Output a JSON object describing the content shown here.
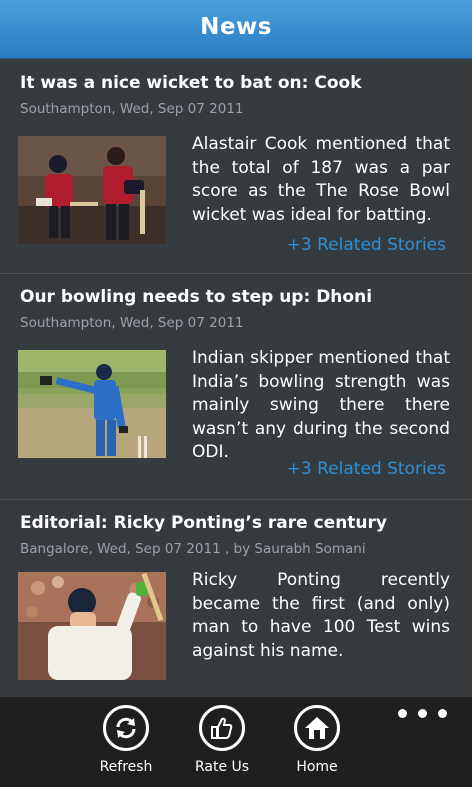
{
  "header": {
    "title": "News"
  },
  "articles": [
    {
      "title": "It was a nice wicket to bat on: Cook",
      "meta": "Southampton, Wed, Sep 07 2011",
      "summary": "Alastair Cook mentioned that the total of 187 was a par score as the The Rose Bowl wicket was ideal for batting.",
      "related": "+3 Related Stories"
    },
    {
      "title": "Our bowling needs to step up: Dhoni",
      "meta": "Southampton, Wed, Sep 07 2011",
      "summary": "Indian skipper mentioned that India’s bowling strength was mainly swing there there wasn’t any during the second ODI.",
      "related": "+3 Related Stories"
    },
    {
      "title": "Editorial: Ricky Ponting’s rare century",
      "meta": "Bangalore, Wed, Sep 07 2011 , by Saurabh Somani",
      "summary": "Ricky Ponting recently became the first (and only) man to have 100 Test wins against his name."
    }
  ],
  "appbar": {
    "buttons": [
      {
        "label": "Refresh",
        "icon": "refresh-icon"
      },
      {
        "label": "Rate Us",
        "icon": "thumbs-up-icon"
      },
      {
        "label": "Home",
        "icon": "home-icon"
      }
    ],
    "more_icon": "ellipsis-icon"
  },
  "colors": {
    "header": "#2f86c9",
    "background": "#363b40",
    "accent": "#2d8fd5",
    "appbar": "#1f1f1f"
  }
}
